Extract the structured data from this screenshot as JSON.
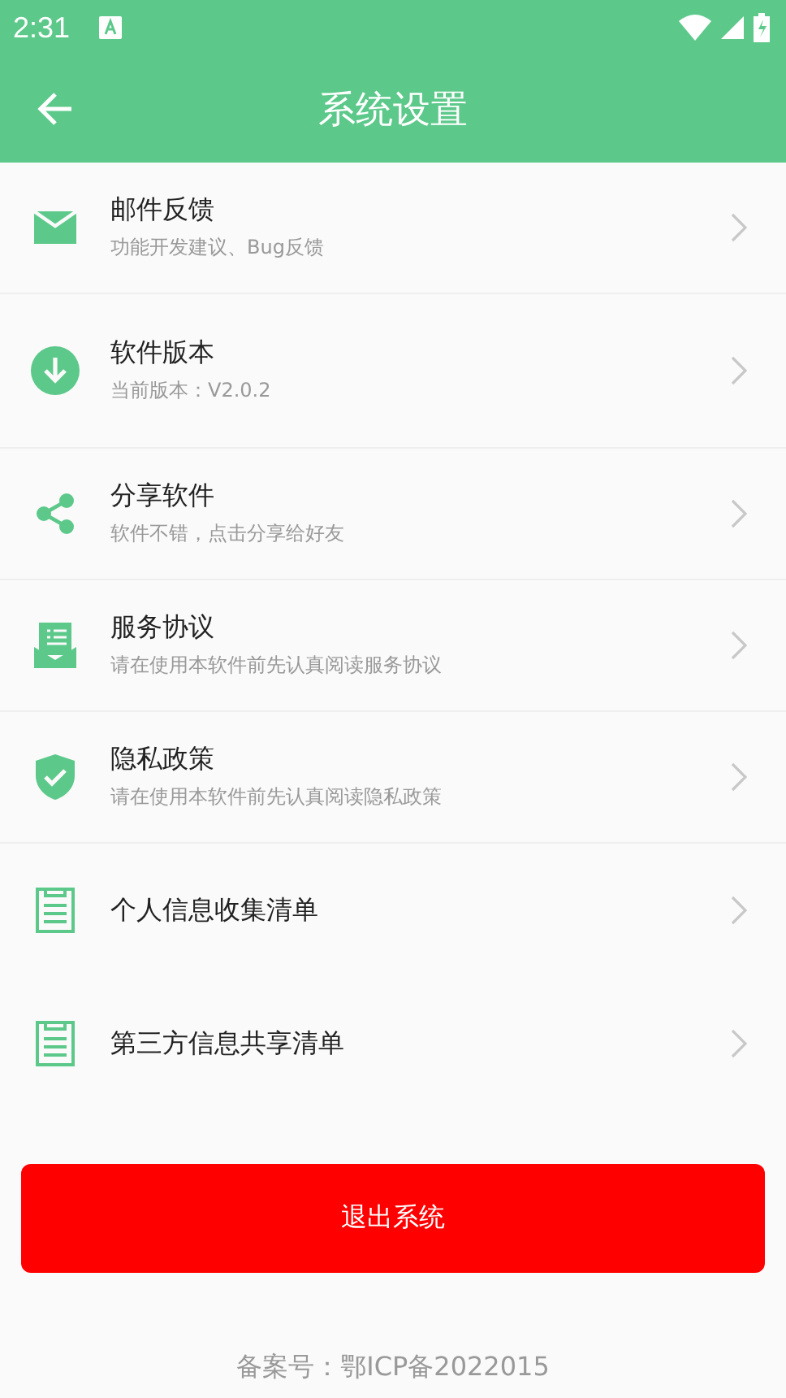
{
  "status_bar": {
    "time": "2:31"
  },
  "toolbar": {
    "title": "系统设置"
  },
  "items": [
    {
      "title": "邮件反馈",
      "subtitle": "功能开发建议、Bug反馈"
    },
    {
      "title": "软件版本",
      "subtitle": "当前版本：V2.0.2"
    },
    {
      "title": "分享软件",
      "subtitle": "软件不错，点击分享给好友"
    },
    {
      "title": "服务协议",
      "subtitle": "请在使用本软件前先认真阅读服务协议"
    },
    {
      "title": "隐私政策",
      "subtitle": "请在使用本软件前先认真阅读隐私政策"
    },
    {
      "title": "个人信息收集清单"
    },
    {
      "title": "第三方信息共享清单"
    }
  ],
  "logout_button": "退出系统",
  "footer": "备案号：鄂ICP备2022015"
}
